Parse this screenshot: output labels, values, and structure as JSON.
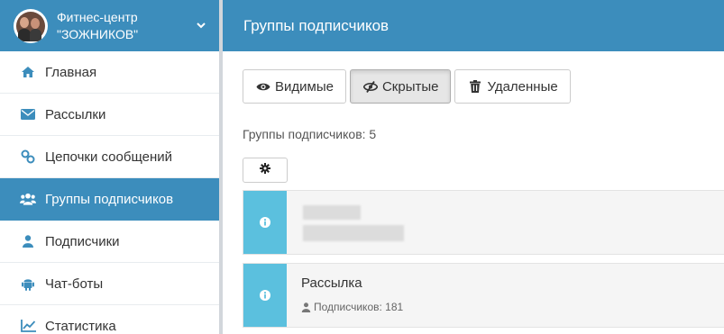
{
  "account": {
    "name": "Фитнес-центр\n\"ЗОЖНИКОВ\""
  },
  "header": {
    "title": "Группы подписчиков"
  },
  "sidebar": {
    "items": [
      {
        "label": "Главная",
        "icon": "home-icon"
      },
      {
        "label": "Рассылки",
        "icon": "envelope-icon"
      },
      {
        "label": "Цепочки сообщений",
        "icon": "link-icon"
      },
      {
        "label": "Группы подписчиков",
        "icon": "users-icon",
        "active": true
      },
      {
        "label": "Подписчики",
        "icon": "user-icon"
      },
      {
        "label": "Чат-боты",
        "icon": "android-icon"
      },
      {
        "label": "Статистика",
        "icon": "chart-icon"
      }
    ]
  },
  "filters": {
    "visible": "Видимые",
    "hidden": "Скрытые",
    "deleted": "Удаленные",
    "active": "hidden"
  },
  "groups_count": "Группы подписчиков: 5",
  "groups": [
    {
      "title": "",
      "subscribers": ""
    },
    {
      "title": "Рассылка",
      "subscribers": "Подписчиков: 181"
    }
  ],
  "colors": {
    "primary": "#3c8dbc",
    "info": "#5bc0de"
  }
}
